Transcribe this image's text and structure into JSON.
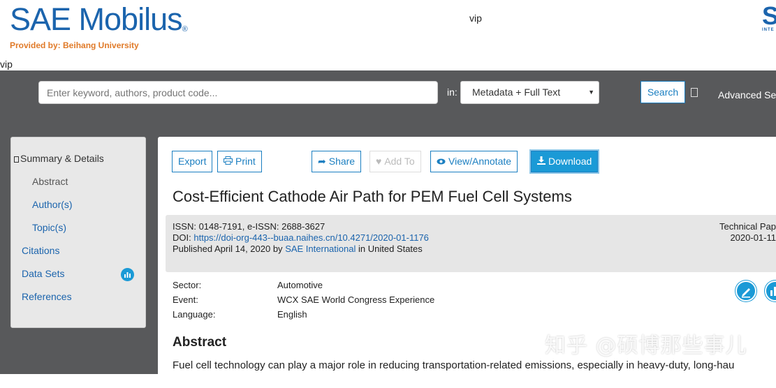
{
  "header": {
    "logo_text": "SAE Mobilus",
    "logo_mark": "®",
    "provided_by": "Provided by: Beihang University",
    "vip_center": "vip",
    "vip_left": "vip",
    "corner_logo_letter": "S",
    "corner_logo_sub": "INTE"
  },
  "search": {
    "placeholder": "Enter keyword, authors, product code...",
    "in_label": "in:",
    "scope_selected": "Metadata + Full Text",
    "search_button": "Search",
    "advanced_search": "Advanced Se"
  },
  "sidebar": {
    "items": [
      {
        "label": "Summary & Details"
      },
      {
        "label": "Abstract"
      },
      {
        "label": "Author(s)"
      },
      {
        "label": "Topic(s)"
      },
      {
        "label": "Citations"
      },
      {
        "label": "Data Sets"
      },
      {
        "label": "References"
      }
    ]
  },
  "toolbar": {
    "export": "Export",
    "print": "Print",
    "share": "Share",
    "add_to": "Add To",
    "view_annotate": "View/Annotate",
    "download": "Download"
  },
  "document": {
    "title": "Cost-Efficient Cathode Air Path for PEM Fuel Cell Systems",
    "issn_line": "ISSN: 0148-7191, e-ISSN: 2688-3627",
    "doi_label": "DOI:",
    "doi_link": "https://doi-org-443--buaa.naihes.cn/10.4271/2020-01-1176",
    "published_prefix": "Published April 14, 2020 by",
    "publisher": "SAE International",
    "published_suffix": "in United States",
    "type": "Technical Pap",
    "number": "2020-01-11",
    "sector_label": "Sector:",
    "sector_value": "Automotive",
    "event_label": "Event:",
    "event_value": "WCX SAE World Congress Experience",
    "language_label": "Language:",
    "language_value": "English",
    "abstract_heading": "Abstract",
    "abstract_text": "Fuel cell technology can play a major role in reducing transportation-related emissions, especially in heavy-duty, long-hau"
  },
  "watermark": "知乎 @硕博那些事儿",
  "colors": {
    "brand_blue": "#1b64ad",
    "accent_orange": "#e07a28",
    "band_gray": "#58595b",
    "button_blue": "#1b9ad6"
  }
}
